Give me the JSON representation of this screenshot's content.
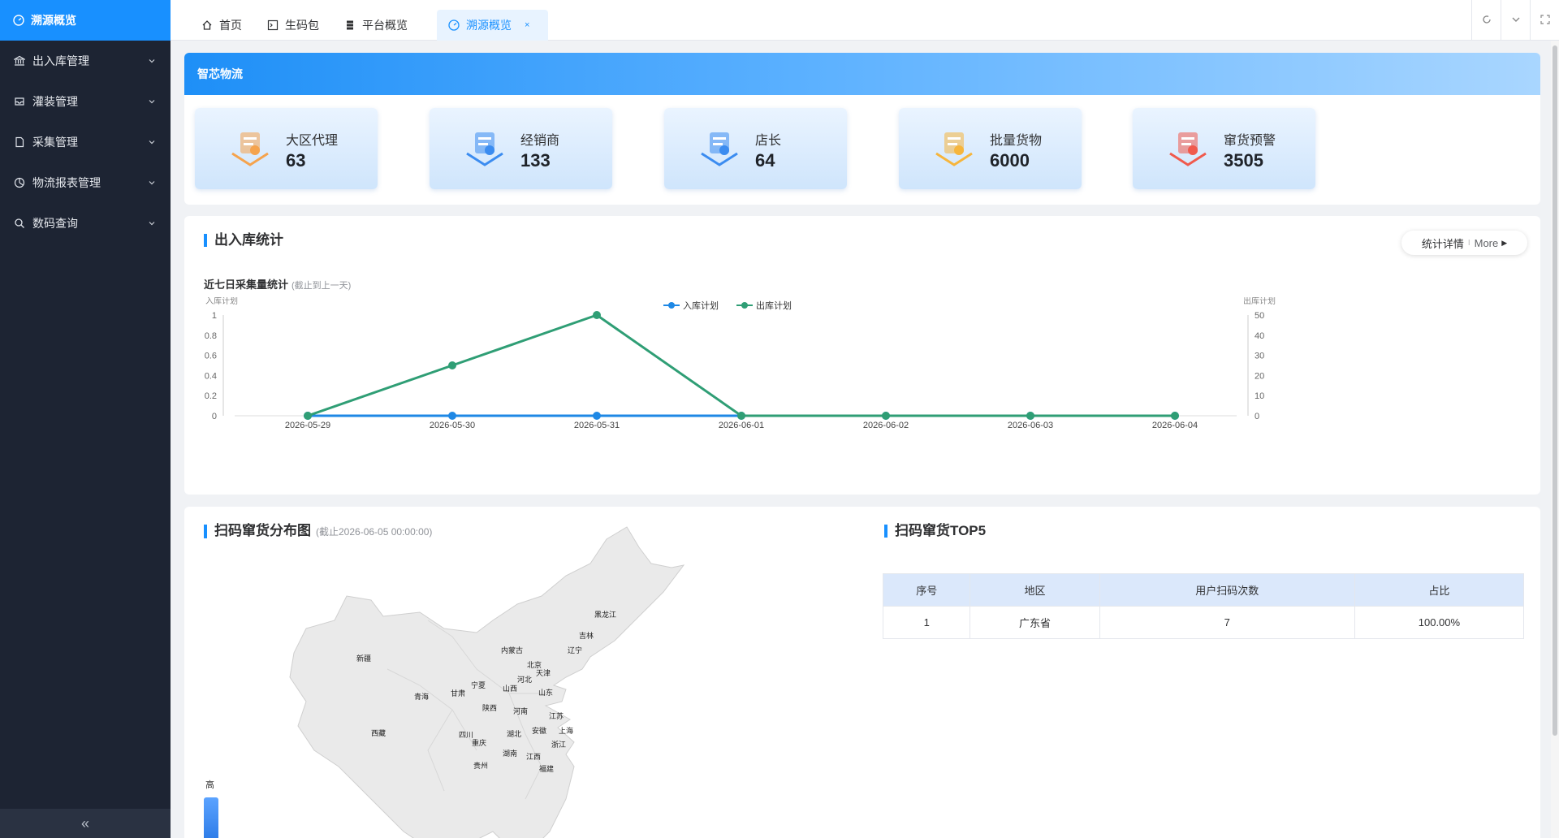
{
  "sidebar": {
    "active_item": "溯源概览",
    "items": [
      {
        "label": "出入库管理",
        "icon": "bank-icon"
      },
      {
        "label": "灌装管理",
        "icon": "inbox-icon"
      },
      {
        "label": "采集管理",
        "icon": "document-icon"
      },
      {
        "label": "物流报表管理",
        "icon": "pie-chart-icon"
      },
      {
        "label": "数码查询",
        "icon": "search-icon"
      }
    ],
    "collapse_glyph": "«"
  },
  "tabs": [
    {
      "label": "首页",
      "icon": "home-icon"
    },
    {
      "label": "生码包",
      "icon": "terminal-icon"
    },
    {
      "label": "平台概览",
      "icon": "server-icon"
    },
    {
      "label": "溯源概览",
      "icon": "dashboard-icon",
      "active": true,
      "close": "×"
    }
  ],
  "brand": {
    "title": "智芯物流"
  },
  "stats": [
    {
      "label": "大区代理",
      "value": "63",
      "color": "#f5a34d"
    },
    {
      "label": "经销商",
      "value": "133",
      "color": "#3b8cf0"
    },
    {
      "label": "店长",
      "value": "64",
      "color": "#3b8cf0"
    },
    {
      "label": "批量货物",
      "value": "6000",
      "color": "#f6b53c"
    },
    {
      "label": "窜货预警",
      "value": "3505",
      "color": "#f05a4d"
    }
  ],
  "io_section": {
    "title": "出入库统计",
    "subtitle": "近七日采集量统计",
    "subtitle_note": "(截止到上一天)",
    "more_label": "统计详情",
    "more_sep": "I",
    "more_en": "More",
    "more_arrow": "▶"
  },
  "chart_data": {
    "type": "line",
    "x": [
      "2026-05-29",
      "2026-05-30",
      "2026-05-31",
      "2026-06-01",
      "2026-06-02",
      "2026-06-03",
      "2026-06-04"
    ],
    "series": [
      {
        "name": "入库计划",
        "axis": "left",
        "color": "#1e88e5",
        "values": [
          0,
          0,
          0,
          0,
          0,
          0,
          0
        ]
      },
      {
        "name": "出库计划",
        "axis": "right",
        "color": "#2f9e75",
        "values": [
          0,
          25,
          50,
          0,
          0,
          0,
          0
        ]
      }
    ],
    "ylabel_left": "入库计划",
    "ylabel_right": "出库计划",
    "ylim_left": [
      0,
      1
    ],
    "yticks_left": [
      "0",
      "0.2",
      "0.4",
      "0.6",
      "0.8",
      "1"
    ],
    "ylim_right": [
      0,
      50
    ],
    "yticks_right": [
      "0",
      "10",
      "20",
      "30",
      "40",
      "50"
    ],
    "legend": "top-center",
    "grid": false
  },
  "map_section": {
    "title": "扫码窜货分布图",
    "note": "(截止2026-06-05 00:00:00)",
    "legend_high": "高",
    "provinces": [
      "黑龙江",
      "吉林",
      "辽宁",
      "内蒙古",
      "北京",
      "天津",
      "河北",
      "新疆",
      "宁夏",
      "山西",
      "山东",
      "青海",
      "甘肃",
      "陕西",
      "河南",
      "江苏",
      "西藏",
      "四川",
      "湖北",
      "安徽",
      "上海",
      "重庆",
      "浙江",
      "湖南",
      "江西",
      "贵州",
      "福建"
    ]
  },
  "top5": {
    "title": "扫码窜货TOP5",
    "headers": [
      "序号",
      "地区",
      "用户扫码次数",
      "占比"
    ],
    "rows": [
      [
        "1",
        "广东省",
        "7",
        "100.00%"
      ]
    ]
  }
}
